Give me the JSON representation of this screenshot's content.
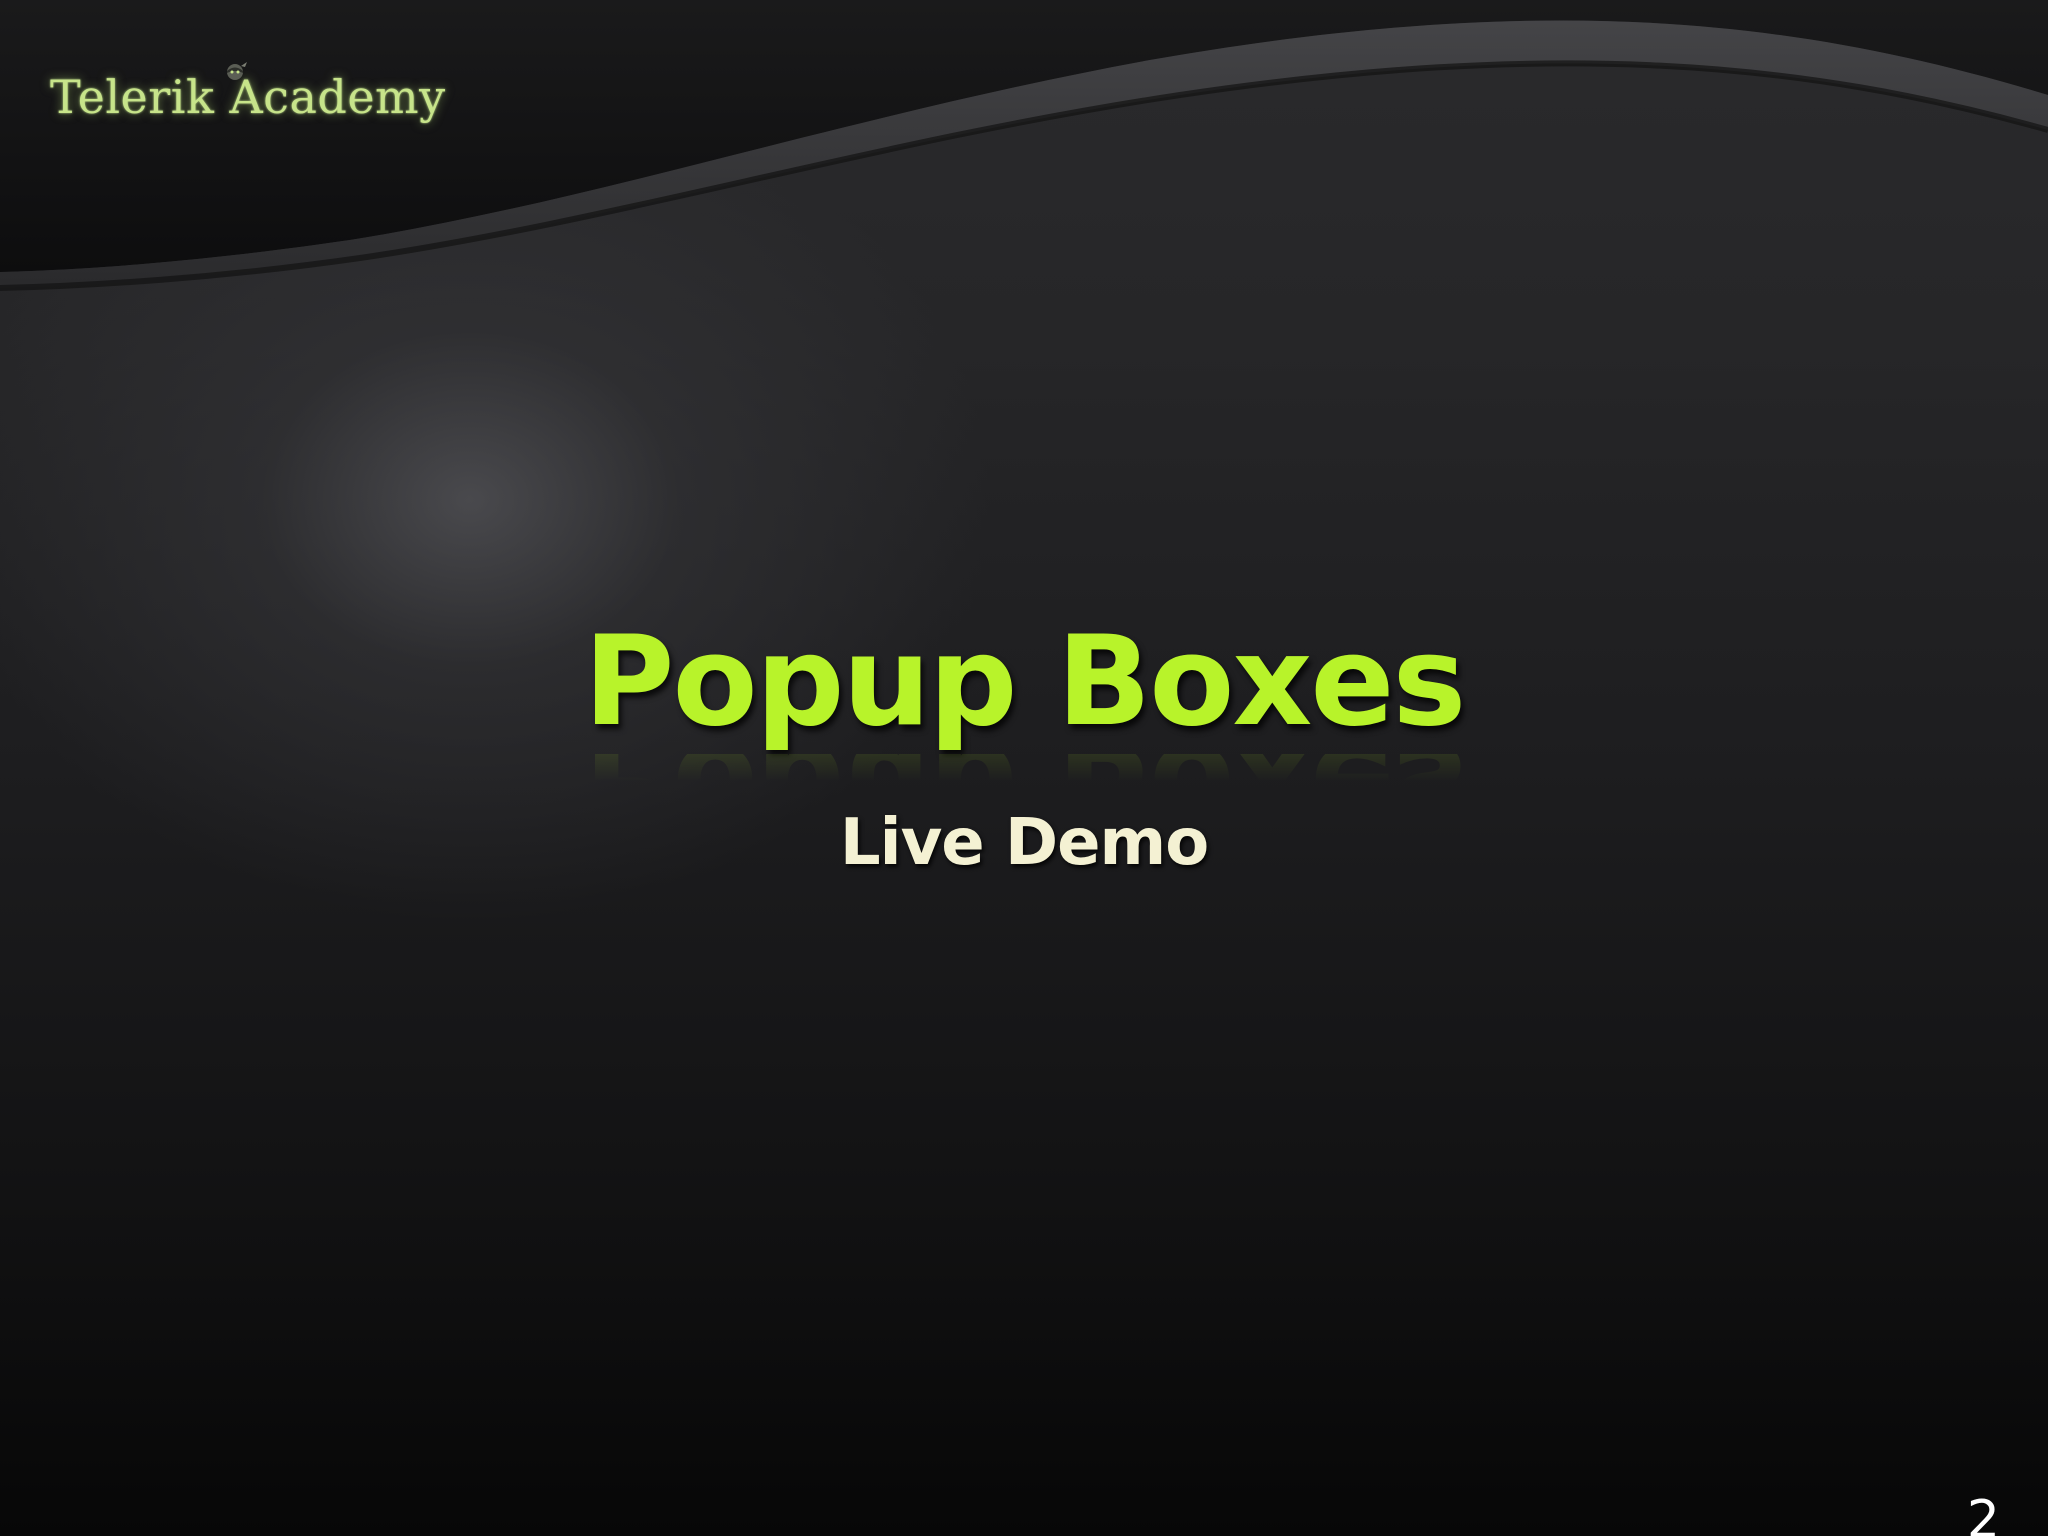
{
  "slide": {
    "logo_text": "Telerik Academy",
    "title": "Popup Boxes",
    "subtitle": "Live Demo",
    "page_number": "2"
  },
  "colors": {
    "title": "#b8f32a",
    "subtitle": "#f4f1d3",
    "logo": "#c7e48a",
    "background": "#1d1d1f"
  },
  "icons": {
    "logo": "telerik-ninja-icon"
  }
}
